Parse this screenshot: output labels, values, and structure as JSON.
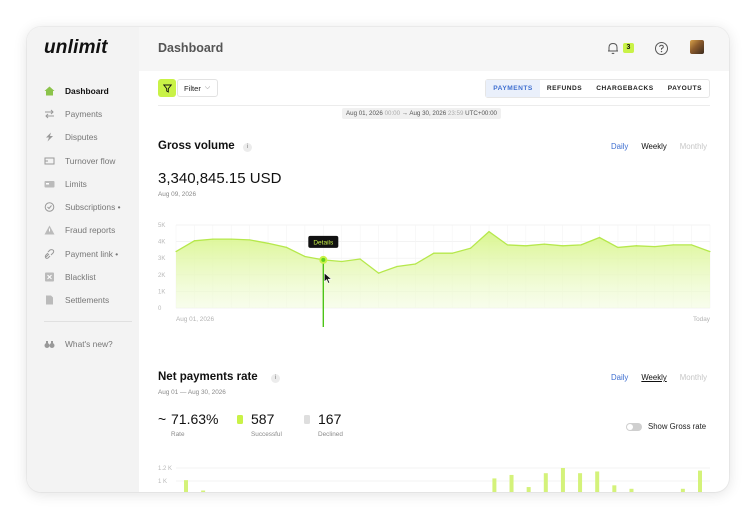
{
  "sidebar": {
    "logo": "unlimit",
    "items": [
      {
        "label": "Dashboard",
        "icon": "home-icon",
        "active": true
      },
      {
        "label": "Payments",
        "icon": "arrows-icon"
      },
      {
        "label": "Disputes",
        "icon": "bolt-icon"
      },
      {
        "label": "Turnover flow",
        "icon": "flow-icon"
      },
      {
        "label": "Limits",
        "icon": "card-icon"
      },
      {
        "label": "Subscriptions •",
        "icon": "check-circle-icon"
      },
      {
        "label": "Fraud reports",
        "icon": "warning-icon"
      },
      {
        "label": "Payment link •",
        "icon": "link-icon"
      },
      {
        "label": "Blacklist",
        "icon": "block-icon"
      },
      {
        "label": "Settlements",
        "icon": "document-icon"
      }
    ],
    "whats_new": {
      "label": "What's new?",
      "icon": "binoculars-icon"
    }
  },
  "header": {
    "title": "Dashboard",
    "notifications_count": "3",
    "accent": "#c9f247"
  },
  "toolbar": {
    "filter_label": "Filter",
    "tabs": [
      {
        "label": "PAYMENTS",
        "active": true
      },
      {
        "label": "REFUNDS"
      },
      {
        "label": "CHARGEBACKS"
      },
      {
        "label": "PAYOUTS"
      }
    ],
    "date_start": "Aug 01, 2026",
    "time_start": "00:00",
    "arrow": "→",
    "date_end": "Aug 30, 2026",
    "time_end": "23:59",
    "timezone": "UTC+00:00"
  },
  "gross_volume": {
    "title": "Gross volume",
    "info": "i",
    "periods": [
      "Daily",
      "Weekly",
      "Monthly"
    ],
    "value": "3,340,845.15 USD",
    "date": "Aug 09, 2026",
    "tooltip": "Details",
    "x_start": "Aug 01, 2026",
    "x_end": "Today"
  },
  "net_payments": {
    "title": "Net payments rate",
    "info": "i",
    "periods": [
      "Daily",
      "Weekly",
      "Monthly"
    ],
    "date_range": "Aug 01 — Aug 30, 2026",
    "rate_symbol": "~",
    "rate": "71.63%",
    "rate_label": "Rate",
    "successful": "587",
    "successful_label": "Successful",
    "declined": "167",
    "declined_label": "Declined",
    "toggle_label": "Show Gross rate",
    "success_color": "#c9f247",
    "declined_color": "#dedede"
  },
  "chart_data": [
    {
      "type": "area",
      "x": [
        1,
        2,
        3,
        4,
        5,
        6,
        7,
        8,
        9,
        10,
        11,
        12,
        13,
        14,
        15,
        16,
        17,
        18,
        19,
        20,
        21,
        22,
        23,
        24,
        25,
        26,
        27,
        28,
        29,
        30
      ],
      "values": [
        3400,
        4050,
        4150,
        4150,
        4100,
        3900,
        3650,
        3100,
        2900,
        2800,
        2950,
        2100,
        2500,
        2650,
        3300,
        3300,
        3600,
        4600,
        3800,
        3750,
        3850,
        3750,
        3800,
        4250,
        3650,
        3750,
        3700,
        3800,
        3800,
        3400
      ],
      "ylim": [
        0,
        5000
      ],
      "yticks": [
        "5K",
        "4K",
        "3K",
        "2K",
        "1K",
        "0"
      ],
      "highlight_x": 9,
      "grid": true
    },
    {
      "type": "bar",
      "yticks": [
        "1.2 K",
        "1 K"
      ],
      "values": [
        800,
        200,
        0,
        0,
        0,
        0,
        0,
        0,
        0,
        0,
        0,
        0,
        0,
        0,
        0,
        0,
        0,
        0,
        900,
        1100,
        400,
        1200,
        1500,
        1200,
        1300,
        500,
        300,
        0,
        100,
        300,
        1350
      ],
      "grid": true
    }
  ]
}
